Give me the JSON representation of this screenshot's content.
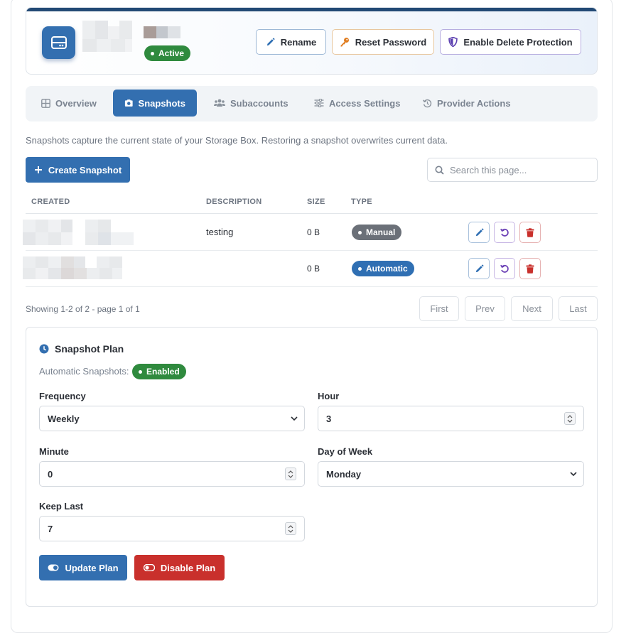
{
  "header": {
    "status": "Active",
    "buttons": {
      "rename": "Rename",
      "reset_password": "Reset Password",
      "delete_protection": "Enable Delete Protection"
    }
  },
  "tabs": [
    {
      "label": "Overview",
      "icon": "grid-icon"
    },
    {
      "label": "Snapshots",
      "icon": "camera-icon",
      "active": true
    },
    {
      "label": "Subaccounts",
      "icon": "users-icon"
    },
    {
      "label": "Access Settings",
      "icon": "sliders-icon"
    },
    {
      "label": "Provider Actions",
      "icon": "history-icon"
    }
  ],
  "intro": "Snapshots capture the current state of your Storage Box. Restoring a snapshot overwrites current data.",
  "toolbar": {
    "create_label": "Create Snapshot",
    "search_placeholder": "Search this page..."
  },
  "table": {
    "columns": [
      "CREATED",
      "DESCRIPTION",
      "SIZE",
      "TYPE"
    ],
    "rows": [
      {
        "description": "testing",
        "size": "0 B",
        "type": "Manual"
      },
      {
        "description": "",
        "size": "0 B",
        "type": "Automatic"
      }
    ]
  },
  "pagination": {
    "showing": "Showing 1-2 of 2 - page 1 of 1",
    "first": "First",
    "prev": "Prev",
    "next": "Next",
    "last": "Last"
  },
  "plan": {
    "title": "Snapshot Plan",
    "auto_label": "Automatic Snapshots:",
    "auto_status": "Enabled",
    "frequency_label": "Frequency",
    "frequency_value": "Weekly",
    "hour_label": "Hour",
    "hour_value": "3",
    "minute_label": "Minute",
    "minute_value": "0",
    "dow_label": "Day of Week",
    "dow_value": "Monday",
    "keep_label": "Keep Last",
    "keep_value": "7",
    "update_label": "Update Plan",
    "disable_label": "Disable Plan"
  },
  "colors": {
    "primary": "#336fb0",
    "success": "#2f8a3e",
    "danger": "#c9302c",
    "header_bar": "#234a75",
    "manual_badge": "#6b7078"
  }
}
